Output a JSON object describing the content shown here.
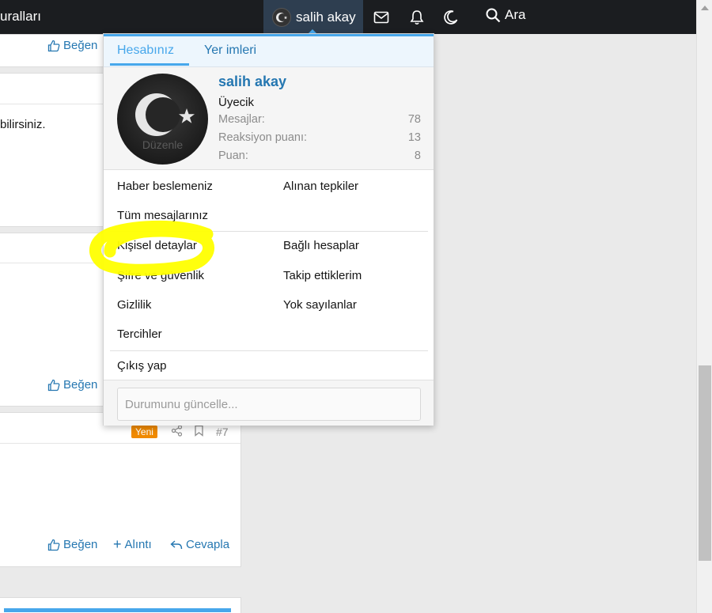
{
  "topbar": {
    "left_title": "uralları",
    "account_name": "salih akay",
    "search_label": "Ara",
    "icons": [
      "mail-icon",
      "bell-icon",
      "moon-icon",
      "search-icon"
    ]
  },
  "posts": {
    "like_label": "Beğen",
    "quote_label": "Alıntı",
    "reply_label": "Cevapla",
    "post2_text": "bilirsiniz.",
    "badge_new": "Yeni",
    "post_number": "#7"
  },
  "menu": {
    "tabs": [
      "Hesabınız",
      "Yer imleri"
    ],
    "profile": {
      "avatar_edit": "Düzenle",
      "name": "salih akay",
      "title": "Üyecik",
      "stats": [
        {
          "label": "Mesajlar:",
          "value": "78"
        },
        {
          "label": "Reaksiyon puanı:",
          "value": "13"
        },
        {
          "label": "Puan:",
          "value": "8"
        }
      ]
    },
    "items": {
      "news_feed": "Haber beslemeniz",
      "reactions_received": "Alınan tepkiler",
      "your_messages": "Tüm mesajlarınız",
      "personal_details": "Kişisel detaylar",
      "connected_accounts": "Bağlı hesaplar",
      "password_security": "Şifre ve güvenlik",
      "following": "Takip ettiklerim",
      "ignoring": "Yok sayılanlar",
      "privacy": "Gizlilik",
      "preferences": "Tercihler",
      "logout": "Çıkış yap"
    },
    "status_placeholder": "Durumunu güncelle..."
  },
  "colors": {
    "topbar_bg": "#1b1d20",
    "accent": "#47a7eb",
    "link": "#2577b1",
    "highlighter": "#ffff00",
    "badge_new": "#f08a00"
  }
}
